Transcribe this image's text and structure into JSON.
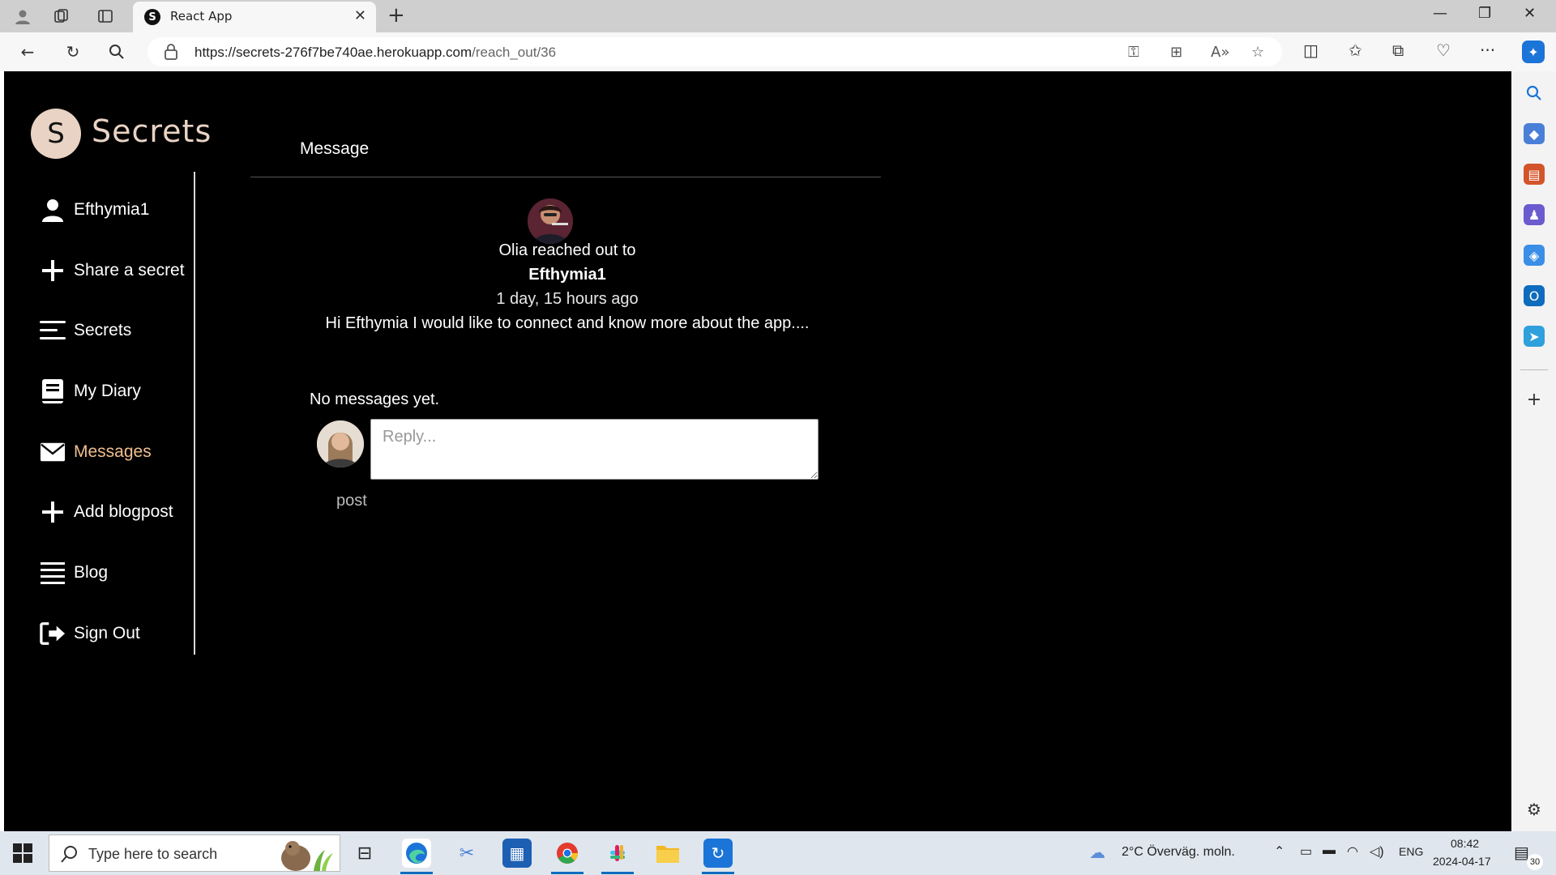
{
  "browser": {
    "tab_title": "React App",
    "tab_favicon_letter": "S",
    "url_host": "https://secrets-276f7be740ae.herokuapp.com",
    "url_path": "/reach_out/36"
  },
  "app": {
    "logo_letter": "S",
    "logo_text": "Secrets",
    "accent_color": "#f0bf8f",
    "logo_color": "#e9d3c4"
  },
  "sidebar": {
    "items": [
      {
        "label": "Efthymia1",
        "icon": "user-icon"
      },
      {
        "label": "Share a secret",
        "icon": "plus-icon"
      },
      {
        "label": "Secrets",
        "icon": "lines-icon"
      },
      {
        "label": "My Diary",
        "icon": "book-icon"
      },
      {
        "label": "Messages",
        "icon": "envelope-icon",
        "active": true
      },
      {
        "label": "Add blogpost",
        "icon": "plus-icon"
      },
      {
        "label": "Blog",
        "icon": "list-icon"
      },
      {
        "label": "Sign Out",
        "icon": "sign-out-icon"
      }
    ]
  },
  "message": {
    "header": "Message",
    "reached_out": "Olia reached out to",
    "recipient": "Efthymia1",
    "time_ago": "1 day, 15 hours ago",
    "body": "Hi Efthymia I would like to connect and know more about the app....",
    "no_messages": "No messages yet.",
    "reply_placeholder": "Reply...",
    "post_label": "post"
  },
  "taskbar": {
    "search_placeholder": "Type here to search",
    "weather": "2°C  Överväg. moln.",
    "language": "ENG",
    "time": "08:42",
    "date": "2024-04-17",
    "notification_count": "30"
  }
}
